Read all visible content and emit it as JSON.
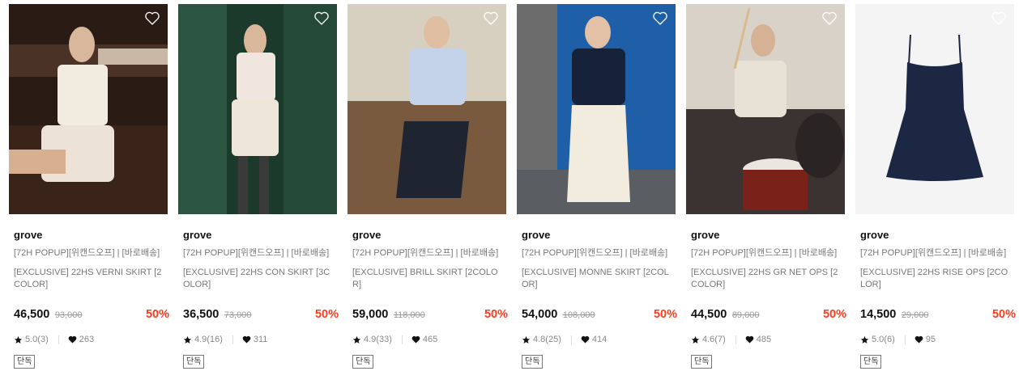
{
  "products": [
    {
      "brand": "grove",
      "promo": "[72H POPUP][위캔드오프] | [바로배송]",
      "name": "[EXCLUSIVE] 22HS VERNI SKIRT [2COLOR]",
      "price": "46,500",
      "original_price": "93,000",
      "discount": "50%",
      "rating": "5.0(3)",
      "likes": "263",
      "badge": "단독"
    },
    {
      "brand": "grove",
      "promo": "[72H POPUP][위캔드오프] | [바로배송]",
      "name": "[EXCLUSIVE] 22HS CON SKIRT [3COLOR]",
      "price": "36,500",
      "original_price": "73,000",
      "discount": "50%",
      "rating": "4.9(16)",
      "likes": "311",
      "badge": "단독"
    },
    {
      "brand": "grove",
      "promo": "[72H POPUP][위캔드오프] | [바로배송]",
      "name": "[EXCLUSIVE] BRILL SKIRT [2COLOR]",
      "price": "59,000",
      "original_price": "118,000",
      "discount": "50%",
      "rating": "4.9(33)",
      "likes": "465",
      "badge": "단독"
    },
    {
      "brand": "grove",
      "promo": "[72H POPUP][위캔드오프] | [바로배송]",
      "name": "[EXCLUSIVE] MONNE SKIRT [2COLOR]",
      "price": "54,000",
      "original_price": "108,000",
      "discount": "50%",
      "rating": "4.8(25)",
      "likes": "414",
      "badge": "단독"
    },
    {
      "brand": "grove",
      "promo": "[72H POPUP][위캔드오프] | [바로배송]",
      "name": "[EXCLUSIVE] 22HS GR NET OPS [2COLOR]",
      "price": "44,500",
      "original_price": "89,000",
      "discount": "50%",
      "rating": "4.6(7)",
      "likes": "485",
      "badge": "단독"
    },
    {
      "brand": "grove",
      "promo": "[72H POPUP][위캔드오프] | [바로배송]",
      "name": "[EXCLUSIVE] 22HS RISE OPS [2COLOR]",
      "price": "14,500",
      "original_price": "29,000",
      "discount": "50%",
      "rating": "5.0(6)",
      "likes": "95",
      "badge": "단독"
    }
  ],
  "colors": {
    "discount": "#ff3b1f",
    "brand_text": "#111111",
    "meta_text": "#777777"
  },
  "icons": {
    "wishlist": "heart-outline-icon",
    "rating": "star-icon",
    "likes": "heart-filled-icon"
  }
}
